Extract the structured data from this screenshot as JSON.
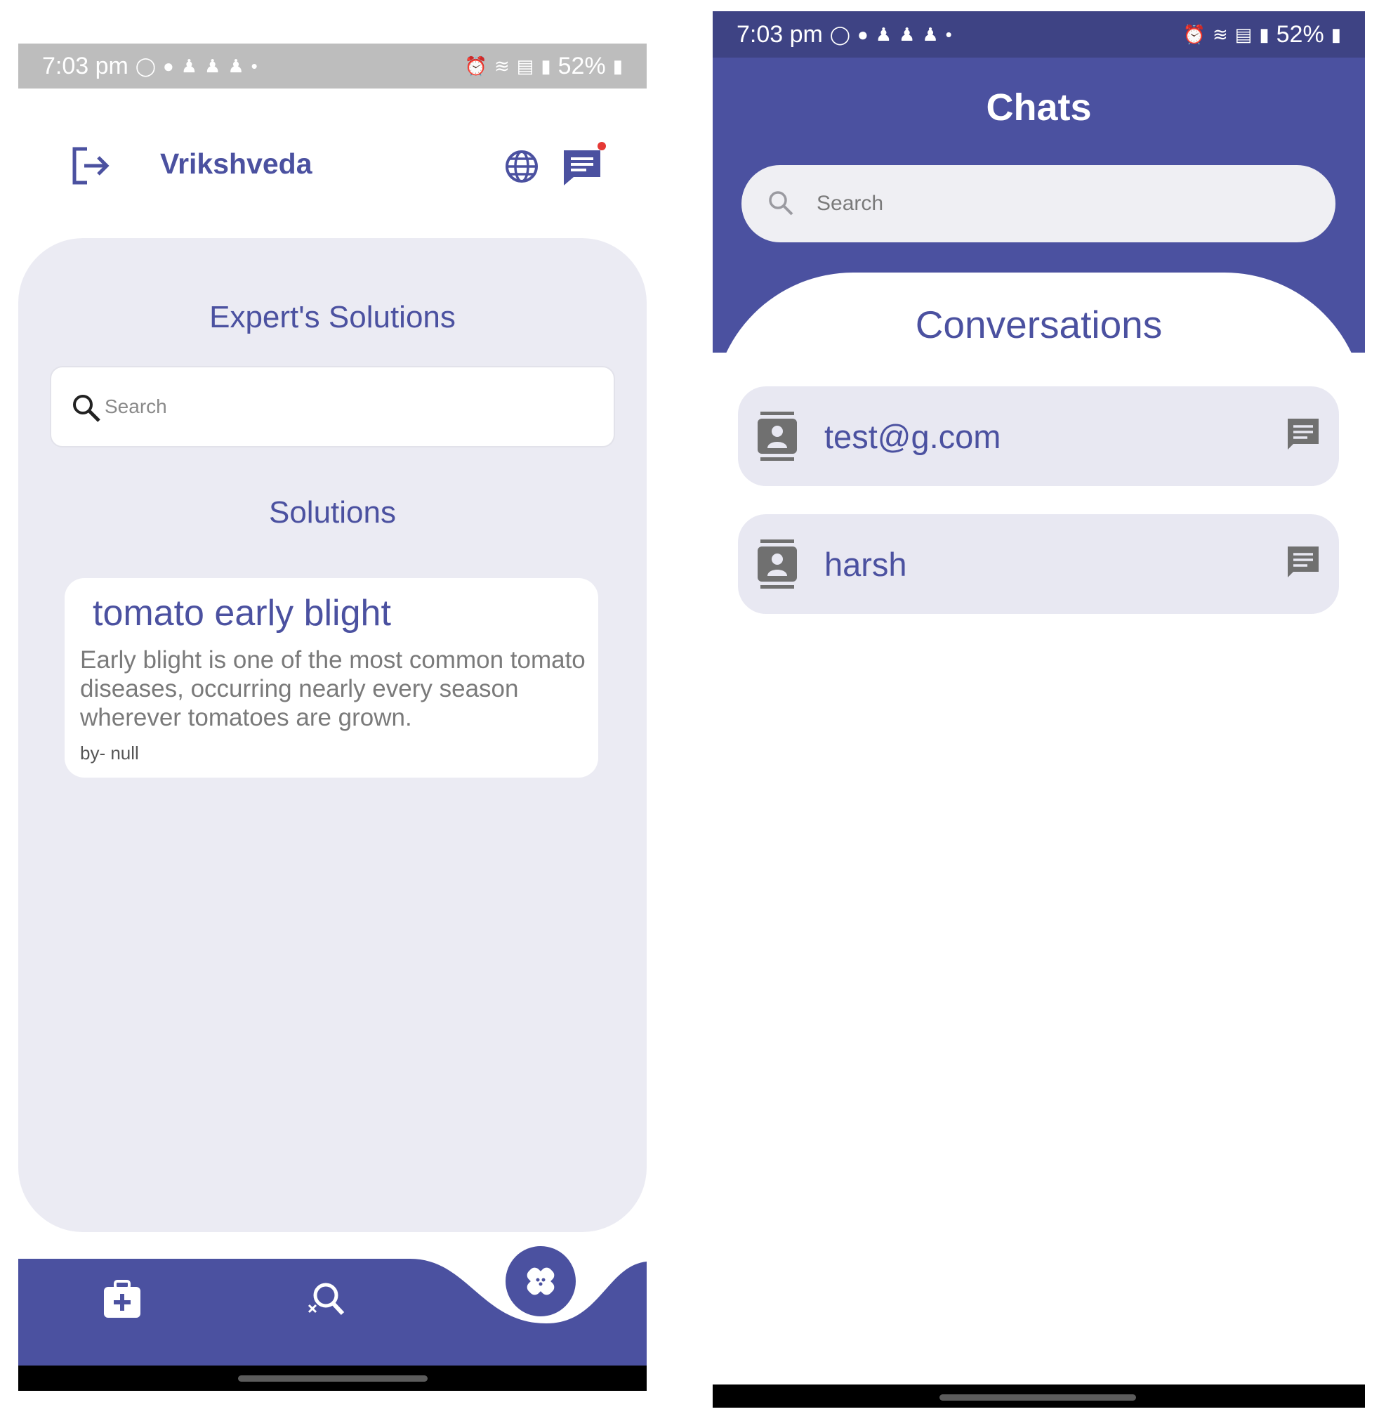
{
  "left_screen": {
    "status_bar": {
      "time": "7:03 pm",
      "battery": "52%"
    },
    "app_bar": {
      "title": "Vrikshveda"
    },
    "panel": {
      "heading": "Expert's Solutions",
      "search_placeholder": "Search",
      "subheading": "Solutions",
      "solutions": [
        {
          "title": "tomato early blight",
          "description": "Early blight is one of the most common tomato diseases, occurring nearly every season wherever tomatoes are grown.",
          "by": "by- null"
        }
      ]
    },
    "colors": {
      "primary": "#4b51a0",
      "panel_bg": "#ebebf3",
      "notification_dot": "#e53935"
    }
  },
  "right_screen": {
    "status_bar": {
      "time": "7:03 pm",
      "battery": "52%"
    },
    "header": {
      "title": "Chats",
      "search_placeholder": "Search"
    },
    "conversations": {
      "heading": "Conversations",
      "items": [
        {
          "name": "test@g.com"
        },
        {
          "name": "harsh"
        }
      ]
    },
    "colors": {
      "header_bg": "#4b51a0",
      "status_bg": "#3e4384",
      "item_bg": "#e8e8f2"
    }
  }
}
